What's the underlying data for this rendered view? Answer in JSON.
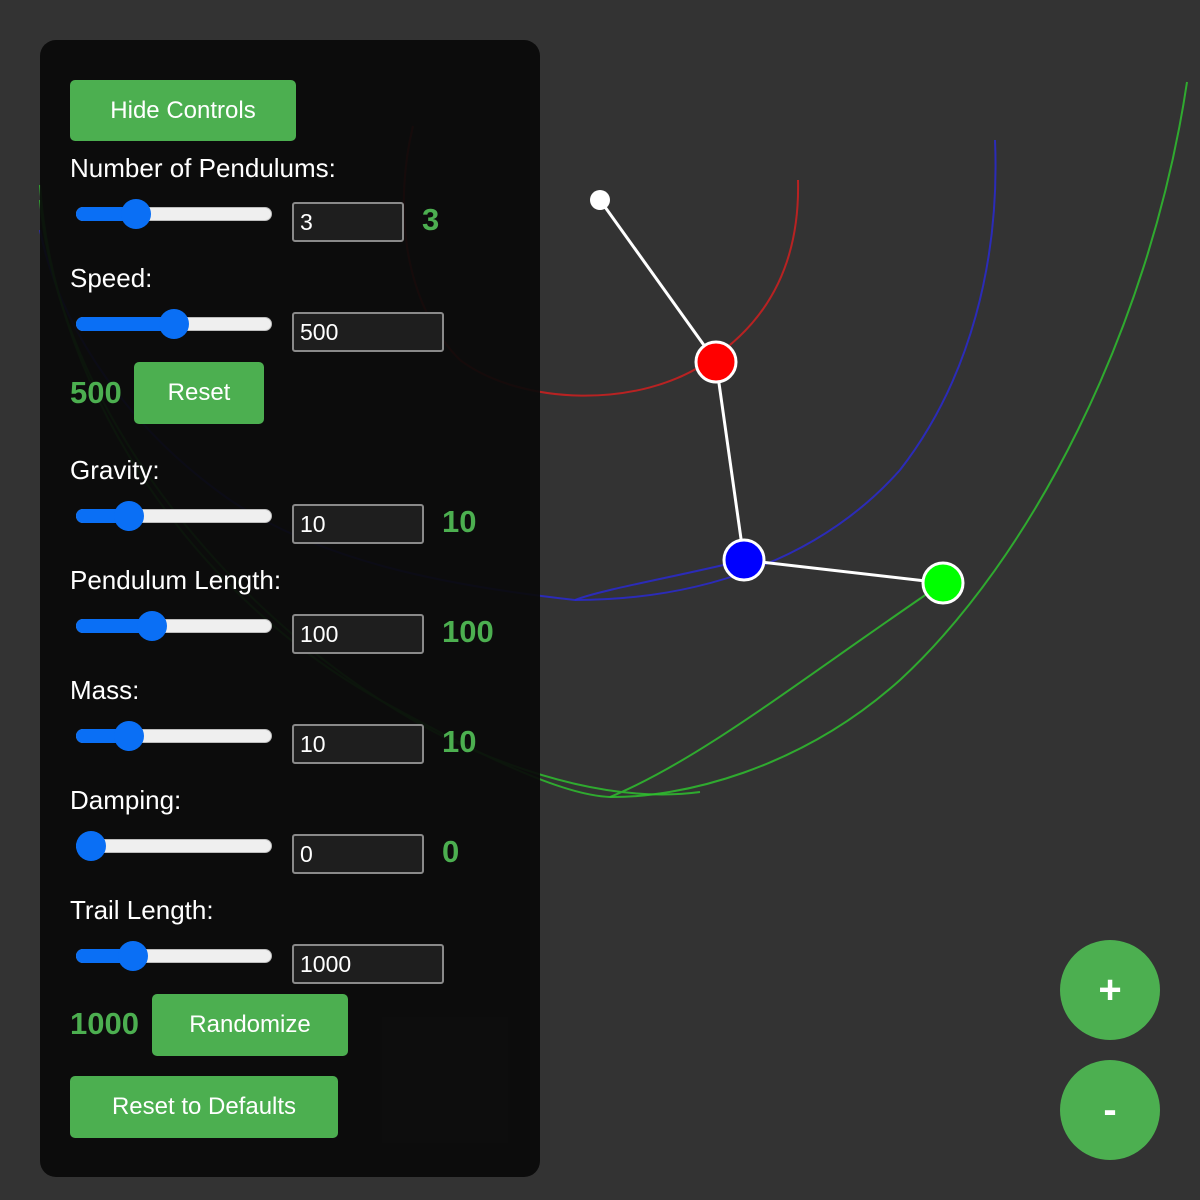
{
  "controls": {
    "hide_label": "Hide Controls",
    "pendulums": {
      "label": "Number of Pendulums:",
      "input": "3",
      "display": "3",
      "slider_fraction": 0.27
    },
    "speed": {
      "label": "Speed:",
      "input": "500",
      "display": "500",
      "reset_label": "Reset",
      "slider_fraction": 0.5
    },
    "gravity": {
      "label": "Gravity:",
      "input": "10",
      "display": "10",
      "slider_fraction": 0.23
    },
    "length": {
      "label": "Pendulum Length:",
      "input": "100",
      "display": "100",
      "slider_fraction": 0.37
    },
    "mass": {
      "label": "Mass:",
      "input": "10",
      "display": "10",
      "slider_fraction": 0.23
    },
    "damping": {
      "label": "Damping:",
      "input": "0",
      "display": "0",
      "slider_fraction": 0.0
    },
    "trail": {
      "label": "Trail Length:",
      "input": "1000",
      "display": "1000",
      "slider_fraction": 0.25
    },
    "randomize_label": "Randomize",
    "reset_defaults_label": "Reset to Defaults"
  },
  "zoom": {
    "in_label": "+",
    "out_label": "-"
  },
  "pendulum_colors": {
    "pivot": "#ffffff",
    "bob1": "#ff0000",
    "bob2": "#0000ff",
    "bob3": "#00ff00",
    "rod": "#ffffff"
  },
  "theme": {
    "accent": "#4caf50",
    "slider": "#0a6ff5",
    "background": "#333333"
  }
}
